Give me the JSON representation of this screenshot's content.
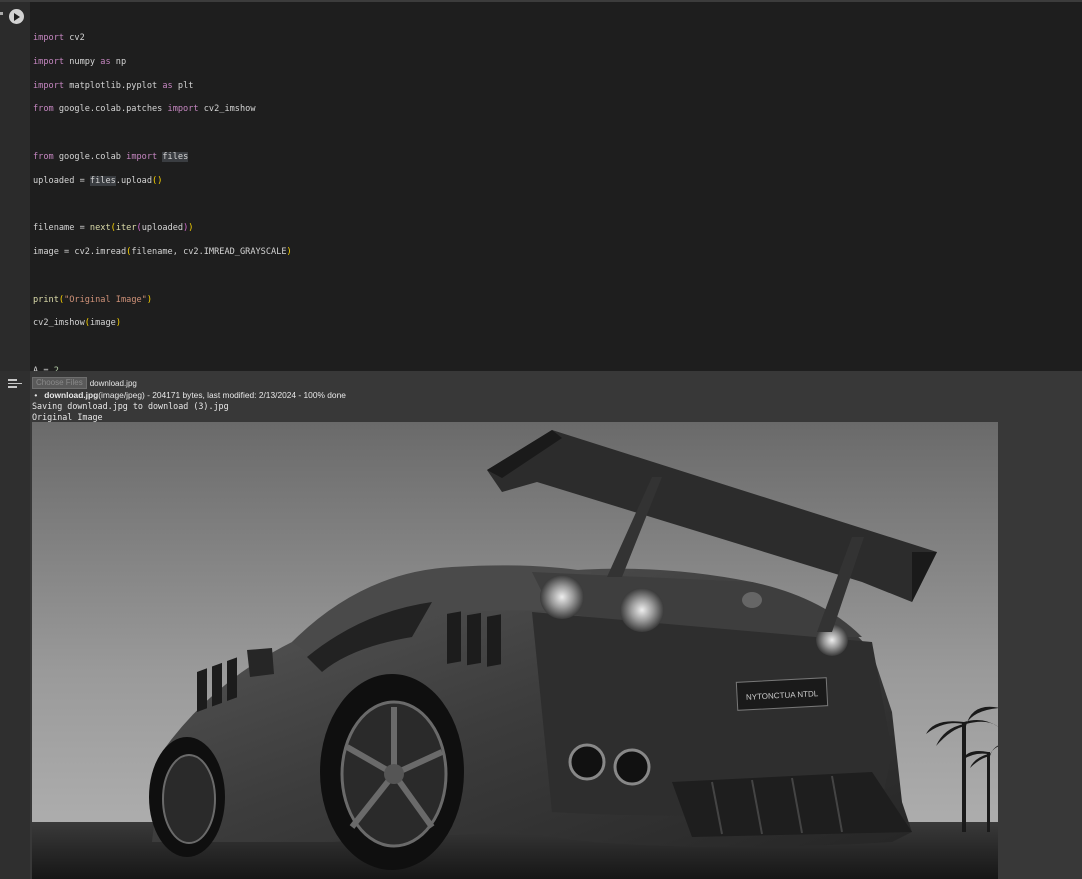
{
  "code_cell": {
    "run_button_label": "Run cell"
  },
  "output": {
    "choose_files_label": "Choose Files",
    "chosen_file": "download.jpg",
    "uploaded_file_name": "download.jpg",
    "uploaded_file_info": "(image/jpeg) - 204171 bytes, last modified: 2/13/2024 - 100% done",
    "saving_line": "Saving download.jpg to download (3).jpg",
    "original_image_line": "Original Image",
    "plate_text": "NYTONCTUA NTDL"
  }
}
